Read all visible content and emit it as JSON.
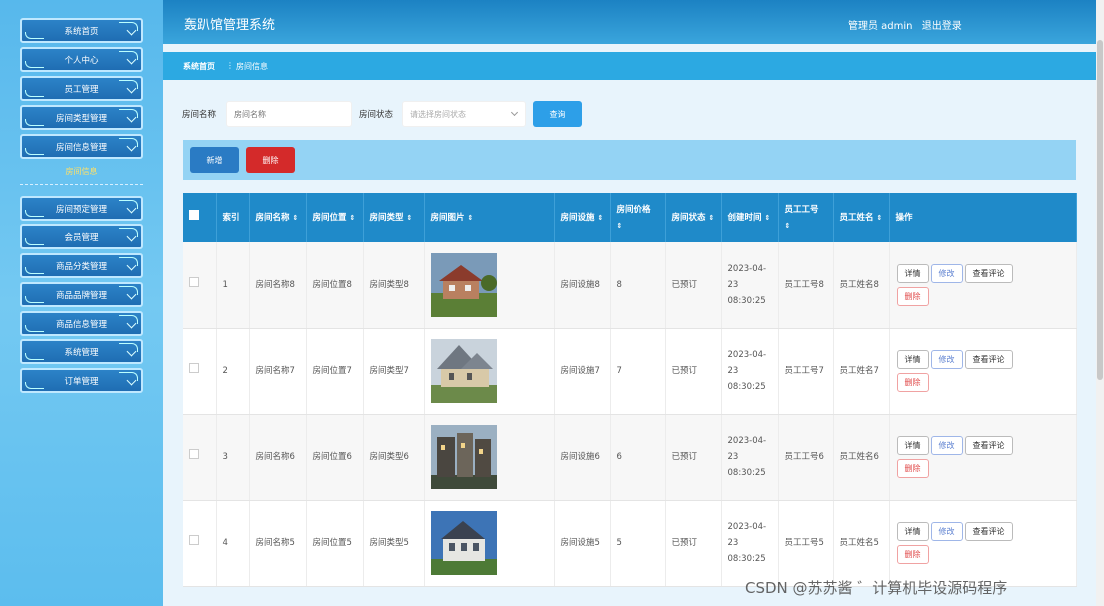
{
  "sidebar": {
    "items": [
      {
        "label": "系统首页"
      },
      {
        "label": "个人中心"
      },
      {
        "label": "员工管理"
      },
      {
        "label": "房间类型管理"
      },
      {
        "label": "房间信息管理"
      },
      {
        "label": "房间预定管理"
      },
      {
        "label": "会员管理"
      },
      {
        "label": "商品分类管理"
      },
      {
        "label": "商品品牌管理"
      },
      {
        "label": "商品信息管理"
      },
      {
        "label": "系统管理"
      },
      {
        "label": "订单管理"
      }
    ],
    "sub_item": "房间信息"
  },
  "header": {
    "title": "轰趴馆管理系统",
    "user": "管理员 admin",
    "logout": "退出登录"
  },
  "breadcrumb": {
    "home": "系统首页",
    "separator": "⋮",
    "current": "房间信息"
  },
  "search": {
    "name_label": "房间名称",
    "name_placeholder": "房间名称",
    "status_label": "房间状态",
    "status_placeholder": "请选择房间状态",
    "query_label": "查询"
  },
  "actions": {
    "add_label": "新增",
    "delete_label": "删除"
  },
  "table": {
    "columns": [
      "索引",
      "房间名称",
      "房间位置",
      "房间类型",
      "房间图片",
      "房间设施",
      "房间价格",
      "房间状态",
      "创建时间",
      "员工工号",
      "员工姓名",
      "操作"
    ],
    "rows": [
      {
        "index": "1",
        "name": "房间名称8",
        "location": "房间位置8",
        "type": "房间类型8",
        "facility": "房间设施8",
        "price": "8",
        "status": "已预订",
        "created": "2023-04-23 08:30:25",
        "emp_no": "员工工号8",
        "emp_name": "员工姓名8"
      },
      {
        "index": "2",
        "name": "房间名称7",
        "location": "房间位置7",
        "type": "房间类型7",
        "facility": "房间设施7",
        "price": "7",
        "status": "已预订",
        "created": "2023-04-23 08:30:25",
        "emp_no": "员工工号7",
        "emp_name": "员工姓名7"
      },
      {
        "index": "3",
        "name": "房间名称6",
        "location": "房间位置6",
        "type": "房间类型6",
        "facility": "房间设施6",
        "price": "6",
        "status": "已预订",
        "created": "2023-04-23 08:30:25",
        "emp_no": "员工工号6",
        "emp_name": "员工姓名6"
      },
      {
        "index": "4",
        "name": "房间名称5",
        "location": "房间位置5",
        "type": "房间类型5",
        "facility": "房间设施5",
        "price": "5",
        "status": "已预订",
        "created": "2023-04-23 08:30:25",
        "emp_no": "员工工号5",
        "emp_name": "员工姓名5"
      }
    ],
    "ops": {
      "detail": "详情",
      "edit": "修改",
      "comments": "查看评论",
      "delete": "删除"
    }
  },
  "watermark": "CSDN @苏苏酱 ゛计算机毕设源码程序"
}
